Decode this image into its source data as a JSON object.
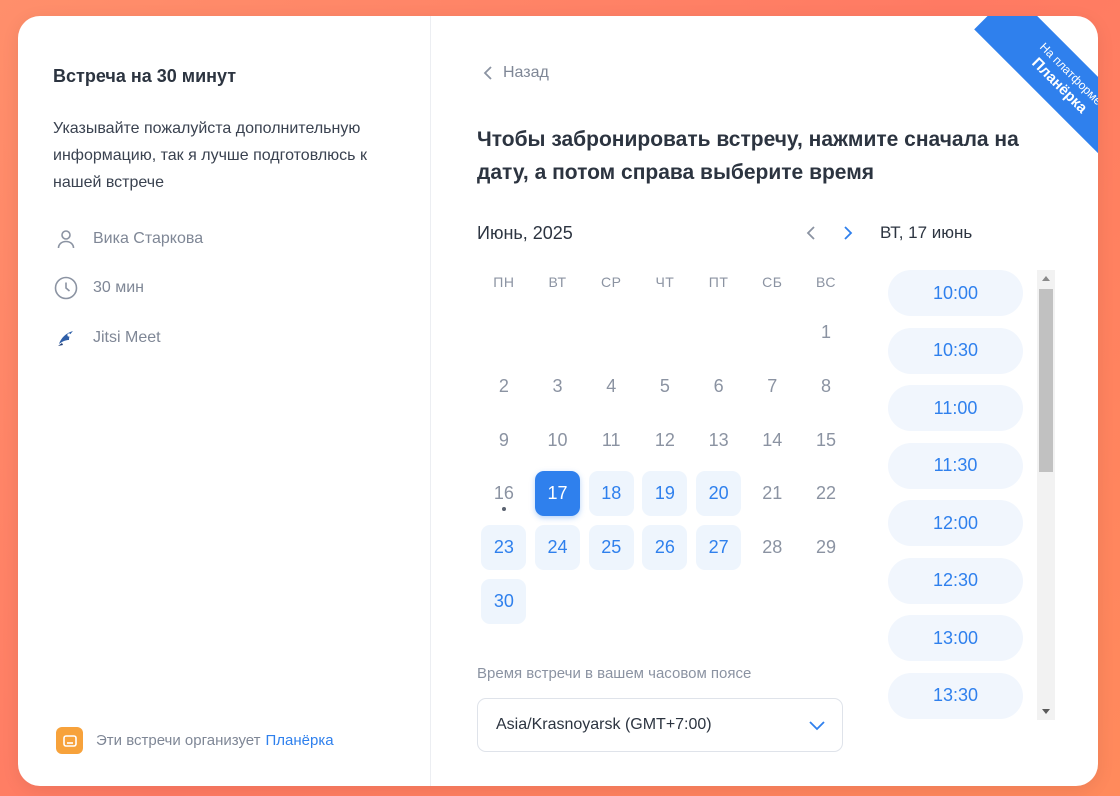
{
  "event": {
    "title": "Встреча на 30 минут",
    "description": "Указывайте пожалуйста дополнительную информацию, так я лучше подготовлюсь к нашей встрече",
    "host": "Вика Старкова",
    "duration": "30 мин",
    "location": "Jitsi Meet"
  },
  "organizer": {
    "text": "Эти встречи организует",
    "link": "Планёрка"
  },
  "back_label": "Назад",
  "headline": "Чтобы забронировать встречу, нажмите сначала на дату, а потом справа выберите время",
  "calendar": {
    "month_label": "Июнь, 2025",
    "weekdays": [
      "ПН",
      "ВТ",
      "СР",
      "ЧТ",
      "ПТ",
      "СБ",
      "ВС"
    ],
    "days": [
      {
        "label": "1",
        "state": "past"
      },
      {
        "label": "2",
        "state": "past"
      },
      {
        "label": "3",
        "state": "past"
      },
      {
        "label": "4",
        "state": "past"
      },
      {
        "label": "5",
        "state": "past"
      },
      {
        "label": "6",
        "state": "past"
      },
      {
        "label": "7",
        "state": "past"
      },
      {
        "label": "8",
        "state": "past"
      },
      {
        "label": "9",
        "state": "past"
      },
      {
        "label": "10",
        "state": "past"
      },
      {
        "label": "11",
        "state": "past"
      },
      {
        "label": "12",
        "state": "past"
      },
      {
        "label": "13",
        "state": "past"
      },
      {
        "label": "14",
        "state": "past"
      },
      {
        "label": "15",
        "state": "past"
      },
      {
        "label": "16",
        "state": "today"
      },
      {
        "label": "17",
        "state": "selected"
      },
      {
        "label": "18",
        "state": "available"
      },
      {
        "label": "19",
        "state": "available"
      },
      {
        "label": "20",
        "state": "available"
      },
      {
        "label": "21",
        "state": "unavailable"
      },
      {
        "label": "22",
        "state": "unavailable"
      },
      {
        "label": "23",
        "state": "available"
      },
      {
        "label": "24",
        "state": "available"
      },
      {
        "label": "25",
        "state": "available"
      },
      {
        "label": "26",
        "state": "available"
      },
      {
        "label": "27",
        "state": "available"
      },
      {
        "label": "28",
        "state": "unavailable"
      },
      {
        "label": "29",
        "state": "unavailable"
      },
      {
        "label": "30",
        "state": "available"
      }
    ]
  },
  "selected_day_label": "ВТ, 17 июнь",
  "time_slots": [
    "10:00",
    "10:30",
    "11:00",
    "11:30",
    "12:00",
    "12:30",
    "13:00",
    "13:30"
  ],
  "timezone": {
    "label": "Время встречи в вашем часовом поясе",
    "value": "Asia/Krasnoyarsk (GMT+7:00)"
  },
  "ribbon": {
    "line1": "На платформе",
    "line2": "Планёрка"
  },
  "colors": {
    "accent": "#2f80ed",
    "background": "#ff8a6a",
    "available_bg": "#eef5fd"
  }
}
